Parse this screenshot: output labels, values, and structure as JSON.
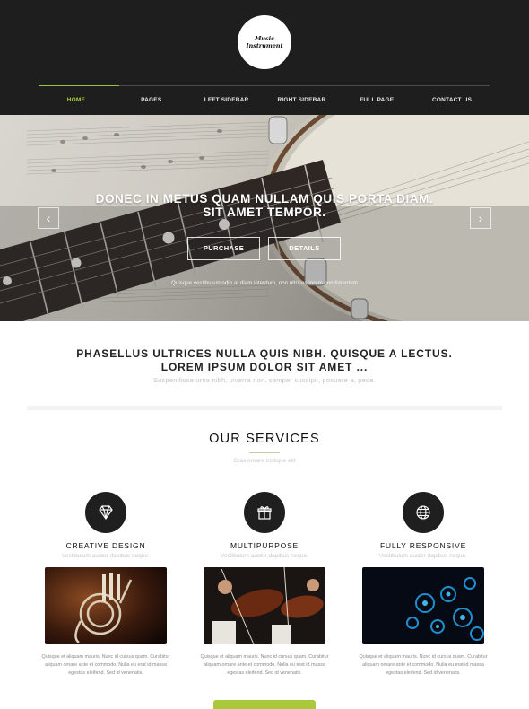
{
  "header": {
    "logo_text": "Music Instrument",
    "nav": [
      {
        "label": "HOME",
        "active": true
      },
      {
        "label": "PAGES"
      },
      {
        "label": "LEFT SIDEBAR"
      },
      {
        "label": "RIGHT SIDEBAR"
      },
      {
        "label": "FULL PAGE"
      },
      {
        "label": "CONTACT US"
      }
    ],
    "accent_color": "#a8cc3f"
  },
  "hero": {
    "title": "DONEC IN METUS QUAM NULLAM QUIS PORTA DIAM. SIT AMET TEMPOR.",
    "purchase_label": "PURCHASE",
    "details_label": "DETAILS",
    "subtitle": "Quisque vestibulum odio at diam interdum, non ultrices lorem condimentum",
    "prev_icon": "chevron-left-icon",
    "next_icon": "chevron-right-icon"
  },
  "intro": {
    "title": "PHASELLUS ULTRICES NULLA QUIS NIBH. QUISQUE A LECTUS. LOREM IPSUM DOLOR SIT AMET ...",
    "subtitle": "Suspendisse urna nibh, viverra non, semper suscipit, posuere a, pede."
  },
  "services": {
    "title": "OUR SERVICES",
    "subtitle": "Cras ornare tristique elit",
    "items": [
      {
        "name": "CREATIVE DESIGN",
        "tagline": "Vestibulum auctor dapibus neque.",
        "icon": "diamond-icon",
        "text": "Quisque et aliquam mauris. Nunc id cursus quam. Curabitur aliquam ornare ante et commodo. Nulla eu erat id massa egestas eleifend. Sed id venenatis."
      },
      {
        "name": "MULTIPURPOSE",
        "tagline": "Vestibulum auctor dapibus neque.",
        "icon": "gift-icon",
        "text": "Quisque et aliquam mauris. Nunc id cursus quam. Curabitur aliquam ornare ante et commodo. Nulla eu erat id massa egestas eleifend. Sed id venenatis."
      },
      {
        "name": "FULLY RESPONSIVE",
        "tagline": "Vestibulum auctor dapibus neque.",
        "icon": "globe-icon",
        "text": "Quisque et aliquam mauris. Nunc id cursus quam. Curabitur aliquam ornare ante et commodo. Nulla eu erat id massa egestas eleifend. Sed id venenatis."
      }
    ]
  }
}
